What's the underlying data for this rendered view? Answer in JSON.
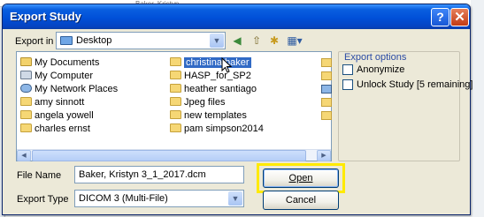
{
  "background": {
    "tab_title": "Baker, Kristyn"
  },
  "dialog": {
    "title": "Export Study",
    "help_glyph": "?",
    "close_glyph": "✕"
  },
  "export_in": {
    "label": "Export in",
    "value": "Desktop"
  },
  "files": [
    {
      "name": "My Documents",
      "icon": "my-documents-icon"
    },
    {
      "name": "My Computer",
      "icon": "my-computer-icon"
    },
    {
      "name": "My Network Places",
      "icon": "network-places-icon"
    },
    {
      "name": "amy sinnott",
      "icon": "folder-icon"
    },
    {
      "name": "angela yowell",
      "icon": "folder-icon"
    },
    {
      "name": "charles ernst",
      "icon": "folder-icon"
    },
    {
      "name": "christina baker",
      "icon": "folder-icon",
      "selected": true
    },
    {
      "name": "HASP_for_SP2",
      "icon": "folder-icon"
    },
    {
      "name": "heather santiago",
      "icon": "folder-icon"
    },
    {
      "name": "Jpeg files",
      "icon": "folder-icon"
    },
    {
      "name": "new templates",
      "icon": "folder-icon"
    },
    {
      "name": "pam simpson2014",
      "icon": "folder-icon"
    }
  ],
  "export_options": {
    "title": "Export options",
    "anonymize": {
      "label": "Anonymize",
      "checked": false
    },
    "unlock": {
      "label": "Unlock Study [5 remaining]",
      "checked": false
    }
  },
  "file_name": {
    "label": "File Name",
    "value": "Baker, Kristyn 3_1_2017.dcm"
  },
  "export_type": {
    "label": "Export Type",
    "value": "DICOM 3 (Multi-File)"
  },
  "buttons": {
    "open": "Open",
    "cancel": "Cancel"
  },
  "colors": {
    "title_bar": "#0a5fe0",
    "highlight": "#ffea00",
    "selection": "#316ac5"
  }
}
